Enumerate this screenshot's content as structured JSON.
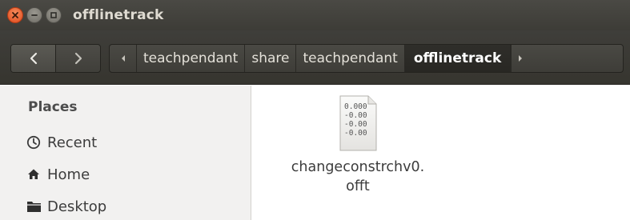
{
  "window": {
    "title": "offlinetrack",
    "controls": [
      "close-icon",
      "minimize-icon",
      "maximize-icon"
    ]
  },
  "toolbar": {
    "back_icon": "chevron-left-icon",
    "forward_icon": "chevron-right-icon",
    "path_overflow_left_icon": "small-arrow-left-icon",
    "path_overflow_right_icon": "small-arrow-right-icon",
    "breadcrumbs": [
      {
        "label": "teachpendant",
        "active": false
      },
      {
        "label": "share",
        "active": false
      },
      {
        "label": "teachpendant",
        "active": false
      },
      {
        "label": "offlinetrack",
        "active": true
      }
    ]
  },
  "sidebar": {
    "heading": "Places",
    "items": [
      {
        "label": "Recent",
        "icon": "clock-icon"
      },
      {
        "label": "Home",
        "icon": "home-icon"
      },
      {
        "label": "Desktop",
        "icon": "folder-icon"
      }
    ]
  },
  "files": [
    {
      "name_line1": "changeconstrchv0.",
      "name_line2": "offt",
      "icon": "text-document-icon",
      "preview_lines": [
        "0.000",
        "-0.00",
        "-0.00",
        "-0.00"
      ]
    }
  ],
  "colors": {
    "titlebar": "#3d3c37",
    "close_button": "#e0491c",
    "sidebar_bg": "#f2f1f0",
    "content_bg": "#ffffff"
  }
}
